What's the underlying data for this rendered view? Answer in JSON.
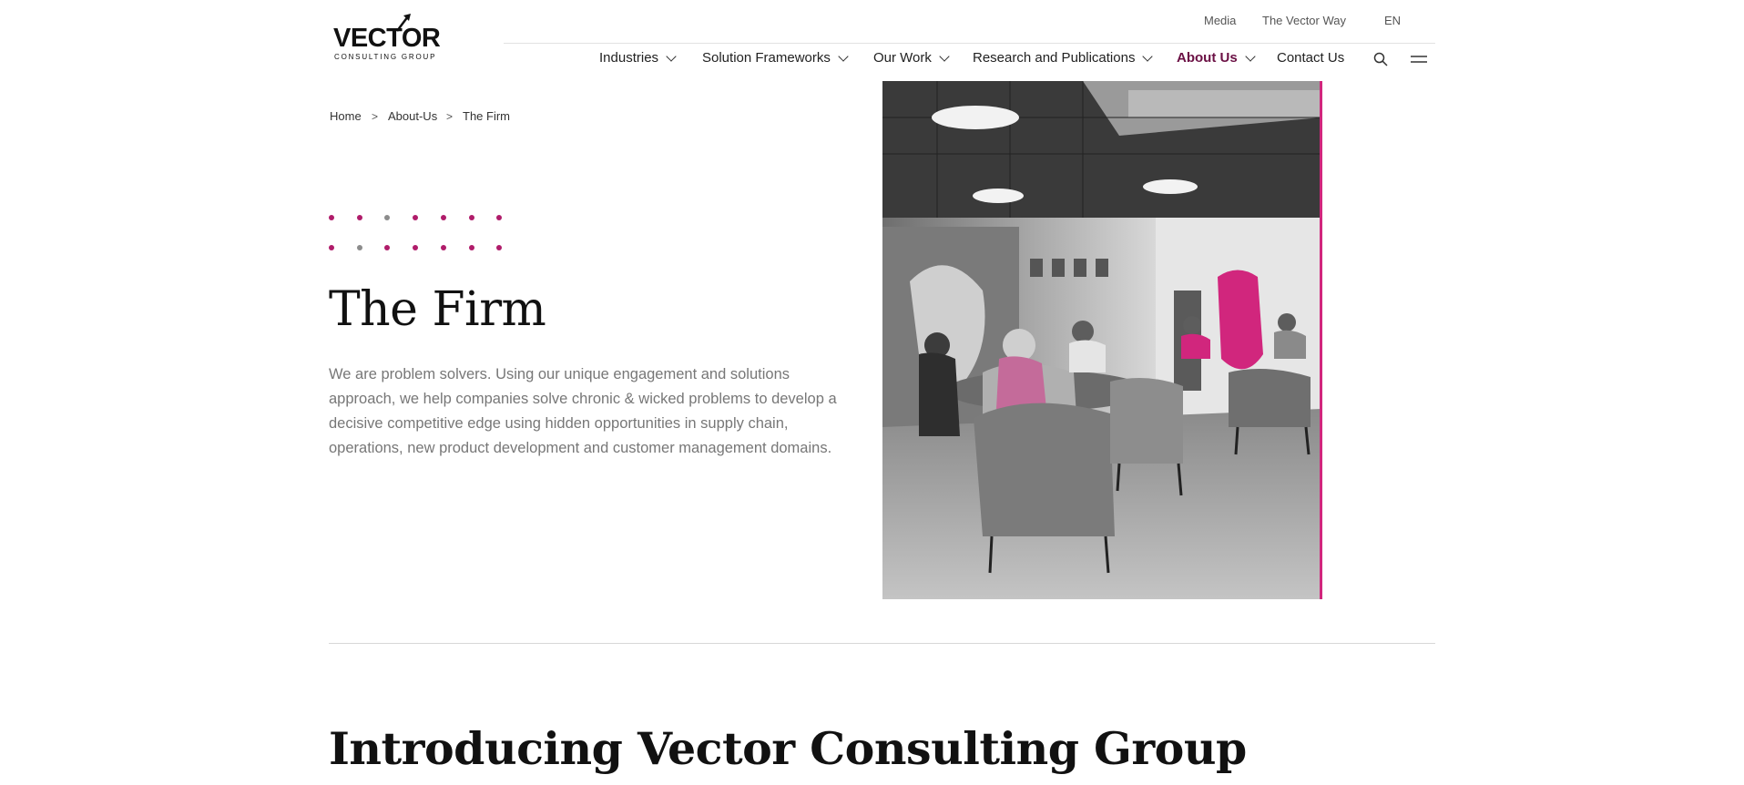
{
  "brand": {
    "name": "VECTOR",
    "tagline": "CONSULTING GROUP"
  },
  "utility_nav": {
    "media": "Media",
    "vector_way": "The Vector Way",
    "language": "EN"
  },
  "main_nav": {
    "items": [
      {
        "label": "Industries",
        "has_dropdown": true
      },
      {
        "label": "Solution Frameworks",
        "has_dropdown": true
      },
      {
        "label": "Our Work",
        "has_dropdown": true
      },
      {
        "label": "Research and Publications",
        "has_dropdown": true
      },
      {
        "label": "About Us",
        "has_dropdown": true,
        "active": true
      },
      {
        "label": "Contact Us",
        "has_dropdown": false
      }
    ],
    "search_icon": "search-icon",
    "menu_icon": "hamburger-menu-icon"
  },
  "breadcrumb": {
    "items": [
      "Home",
      "About-Us",
      "The Firm"
    ],
    "separator": ">"
  },
  "hero": {
    "title": "The Firm",
    "description": "We are problem solvers. Using our unique engagement and solutions approach, we help companies solve chronic & wicked problems to develop a decisive competitive edge using hidden opportunities in supply chain, operations, new product development and customer management domains.",
    "image_subject": "office-lounge-photo"
  },
  "intro": {
    "heading": "Introducing Vector Consulting Group"
  },
  "colors": {
    "accent": "#d1267d",
    "active_nav": "#6b1044",
    "dot_grey": "#8c8c8c",
    "dot_pink": "#b01c6a",
    "body_text": "#777777"
  }
}
